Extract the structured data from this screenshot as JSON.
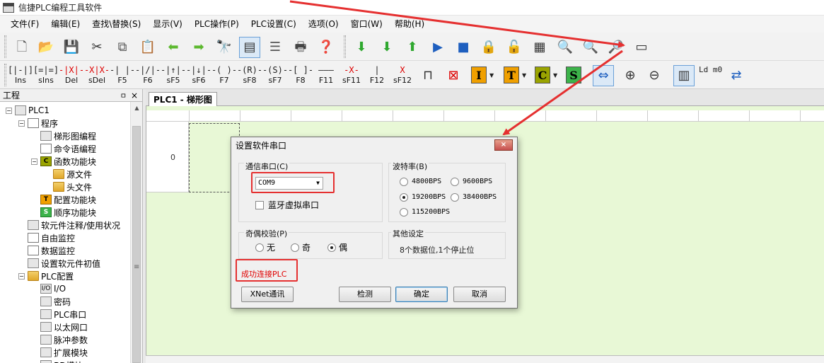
{
  "window": {
    "title": "信捷PLC编程工具软件"
  },
  "menu": [
    "文件(F)",
    "编辑(E)",
    "查找\\替换(S)",
    "显示(V)",
    "PLC操作(P)",
    "PLC设置(C)",
    "选项(O)",
    "窗口(W)",
    "帮助(H)"
  ],
  "toolbar2": {
    "ladder_tools": [
      {
        "label": "Ins",
        "sym": "[|-|]"
      },
      {
        "label": "sIns",
        "sym": "[=|=]"
      },
      {
        "label": "Del",
        "sym": "-|X|-"
      },
      {
        "label": "sDel",
        "sym": "-X|X-"
      },
      {
        "label": "F5",
        "sym": "-| |-"
      },
      {
        "label": "F6",
        "sym": "-|/|-"
      },
      {
        "label": "sF5",
        "sym": "-|↑|-"
      },
      {
        "label": "sF6",
        "sym": "-|↓|-"
      },
      {
        "label": "F7",
        "sym": "-( )-"
      },
      {
        "label": "sF8",
        "sym": "-(R)-"
      },
      {
        "label": "sF7",
        "sym": "-(S)-"
      },
      {
        "label": "F8",
        "sym": "-[ ]-"
      },
      {
        "label": "F11",
        "sym": "———"
      },
      {
        "label": "sF11",
        "sym": "-X-"
      },
      {
        "label": "F12",
        "sym": " | "
      },
      {
        "label": "sF12",
        "sym": " X "
      }
    ],
    "colorboxes": [
      {
        "letter": "I",
        "bg": "#f0a000"
      },
      {
        "letter": "T",
        "bg": "#f0a000"
      },
      {
        "letter": "C",
        "bg": "#9aa400"
      },
      {
        "letter": "S",
        "bg": "#3cb34a"
      }
    ],
    "ld_label": "Ld m0"
  },
  "panel": {
    "title": "工程",
    "pin": "ㅁ",
    "close": "×",
    "tree": [
      {
        "label": "PLC1",
        "level": 0,
        "icon": "plc",
        "expander": "−"
      },
      {
        "label": "程序",
        "level": 1,
        "icon": "doc",
        "expander": "−"
      },
      {
        "label": "梯形图编程",
        "level": 2,
        "icon": "gray"
      },
      {
        "label": "命令语编程",
        "level": 2,
        "icon": "doc"
      },
      {
        "label": "函数功能块",
        "level": 2,
        "icon": "olive",
        "letter": "C",
        "expander": "−"
      },
      {
        "label": "源文件",
        "level": 3,
        "icon": "folder"
      },
      {
        "label": "头文件",
        "level": 3,
        "icon": "folder"
      },
      {
        "label": "配置功能块",
        "level": 2,
        "icon": "orange",
        "letter": "T"
      },
      {
        "label": "顺序功能块",
        "level": 2,
        "icon": "green",
        "letter": "S"
      },
      {
        "label": "软元件注释/使用状况",
        "level": 1,
        "icon": "gray"
      },
      {
        "label": "自由监控",
        "level": 1,
        "icon": "doc"
      },
      {
        "label": "数据监控",
        "level": 1,
        "icon": "doc"
      },
      {
        "label": "设置软元件初值",
        "level": 1,
        "icon": "gray"
      },
      {
        "label": "PLC配置",
        "level": 1,
        "icon": "folder",
        "expander": "−"
      },
      {
        "label": "I/O",
        "level": 2,
        "icon": "gray",
        "letter": "I/O"
      },
      {
        "label": "密码",
        "level": 2,
        "icon": "gray"
      },
      {
        "label": "PLC串口",
        "level": 2,
        "icon": "gray"
      },
      {
        "label": "以太网口",
        "level": 2,
        "icon": "gray"
      },
      {
        "label": "脉冲参数",
        "level": 2,
        "icon": "gray"
      },
      {
        "label": "扩展模块",
        "level": 2,
        "icon": "gray"
      },
      {
        "label": "BD模块",
        "level": 2,
        "icon": "gray"
      }
    ]
  },
  "document": {
    "tab": "PLC1 - 梯形图",
    "row_number": "0"
  },
  "dialog": {
    "title": "设置软件串口",
    "close": "×",
    "port_group": "通信串口(C)",
    "port_value": "COM9",
    "bluetooth": "蓝牙虚拟串口",
    "baud_group": "波特率(B)",
    "baud_options": [
      "4800BPS",
      "9600BPS",
      "19200BPS",
      "38400BPS",
      "115200BPS"
    ],
    "baud_selected": "19200BPS",
    "parity_group": "奇偶校验(P)",
    "parity_options": [
      "无",
      "奇",
      "偶"
    ],
    "parity_selected": "偶",
    "other_group": "其他设定",
    "other_text": "8个数据位,1个停止位",
    "status": "成功连接PLC",
    "buttons": {
      "xnet": "XNet通讯",
      "detect": "检测",
      "ok": "确定",
      "cancel": "取消"
    }
  },
  "colors": {
    "ladder_bg": "#e8f8d6",
    "highlight": "#e53030",
    "status_text": "#e00000"
  }
}
